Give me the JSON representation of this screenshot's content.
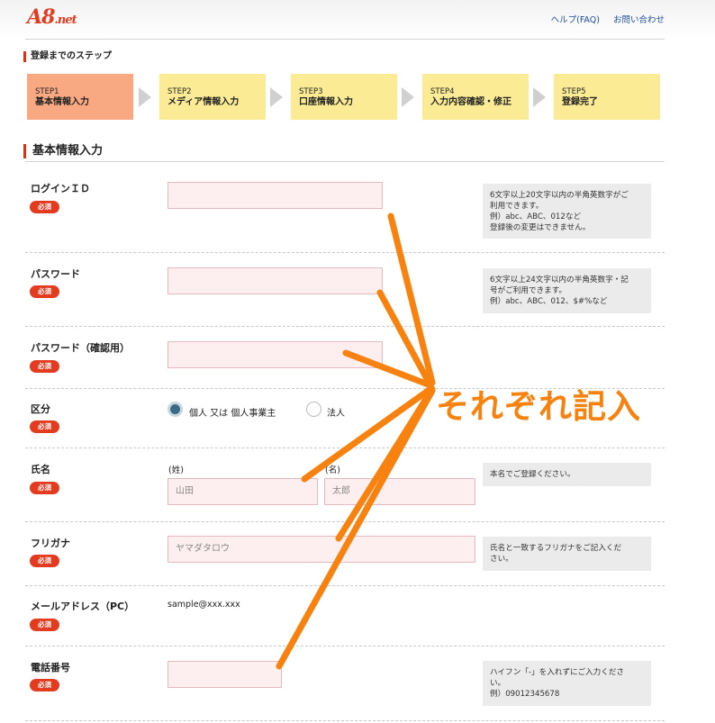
{
  "header": {
    "logo": "A8",
    "logo_suffix": ".net",
    "help_link": "ヘルプ(FAQ)",
    "contact_link": "お問い合わせ"
  },
  "steps": {
    "heading": "登録までのステップ",
    "items": [
      {
        "num": "STEP1",
        "label": "基本情報入力",
        "active": true
      },
      {
        "num": "STEP2",
        "label": "メディア情報入力",
        "active": false
      },
      {
        "num": "STEP3",
        "label": "口座情報入力",
        "active": false
      },
      {
        "num": "STEP4",
        "label": "入力内容確認・修正",
        "active": false
      },
      {
        "num": "STEP5",
        "label": "登録完了",
        "active": false
      }
    ]
  },
  "section_title": "基本情報入力",
  "required_badge": "必須",
  "form": {
    "login_id": {
      "label": "ログインＩＤ",
      "value": "",
      "hint": "6文字以上20文字以内の半角英数字がご\n利用できます。\n例）abc、ABC、012など\n登録後の変更はできません。"
    },
    "password": {
      "label": "パスワード",
      "value": "",
      "hint": "6文字以上24文字以内の半角英数字・記\n号がご利用できます。\n例）abc、ABC、012、$#%など"
    },
    "password_confirm": {
      "label": "パスワード（確認用）",
      "value": ""
    },
    "category": {
      "label": "区分",
      "option_individual": "個人 又は 個人事業主",
      "option_corporate": "法人",
      "selected": "個人 又は 個人事業主"
    },
    "name": {
      "label": "氏名",
      "last_label": "(姓)",
      "first_label": "(名)",
      "last_placeholder": "山田",
      "first_placeholder": "太郎",
      "hint": "本名でご登録ください。"
    },
    "furigana": {
      "label": "フリガナ",
      "placeholder": "ヤマダタロウ",
      "hint": "氏名と一致するフリガナをご記入くだ\nさい。"
    },
    "email": {
      "label": "メールアドレス（PC）",
      "value": "sample@xxx.xxx"
    },
    "phone": {
      "label": "電話番号",
      "value": "",
      "hint": "ハイフン「-」を入れずにご入力くださ\nい。\n例）09012345678"
    }
  },
  "annotation": {
    "text": "それぞれ記入",
    "color": "#f7820f"
  },
  "colors": {
    "brand_red": "#e23b1f",
    "step_active": "#f9a982",
    "step_inactive": "#faeb94",
    "input_bg": "#fdeff0",
    "link_blue": "#1b4f9c"
  }
}
